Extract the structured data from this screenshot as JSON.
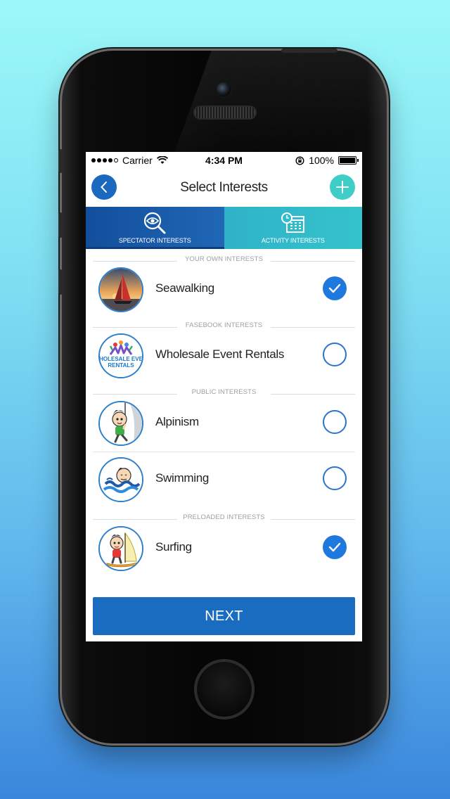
{
  "status_bar": {
    "carrier": "Carrier",
    "time": "4:34 PM",
    "battery_percent": "100%"
  },
  "header": {
    "title": "Select Interests",
    "back_icon": "chevron-left-icon",
    "add_icon": "plus-icon"
  },
  "tabs": [
    {
      "label": "SPECTATOR INTERESTS",
      "icon": "eye-search-icon",
      "selected": true
    },
    {
      "label": "ACTIVITY INTERESTS",
      "icon": "calendar-clock-icon",
      "selected": false
    }
  ],
  "sections": {
    "own": "YOUR OWN INTERESTS",
    "facebook": "FASEBOOK INTERESTS",
    "public": "PUBLIC INTERESTS",
    "preloaded": "PRELOADED INTERESTS"
  },
  "interests": [
    {
      "name": "Seawalking",
      "selected": true,
      "avatar": "sailboat-sunset-photo"
    },
    {
      "name": "Wholesale Event Rentals",
      "selected": false,
      "avatar": "wholesale-event-rentals-logo",
      "logo_text": "HOLESALE EVE RENTALS"
    },
    {
      "name": "Alpinism",
      "selected": false,
      "avatar": "climbing-kid-cartoon"
    },
    {
      "name": "Swimming",
      "selected": false,
      "avatar": "swimming-kid-cartoon"
    },
    {
      "name": "Surfing",
      "selected": true,
      "avatar": "sailing-kid-cartoon"
    }
  ],
  "footer": {
    "next_label": "NEXT"
  },
  "colors": {
    "primary_blue": "#1a6cc0",
    "accent_teal": "#3ecdc7",
    "check_blue": "#1f78dd"
  }
}
